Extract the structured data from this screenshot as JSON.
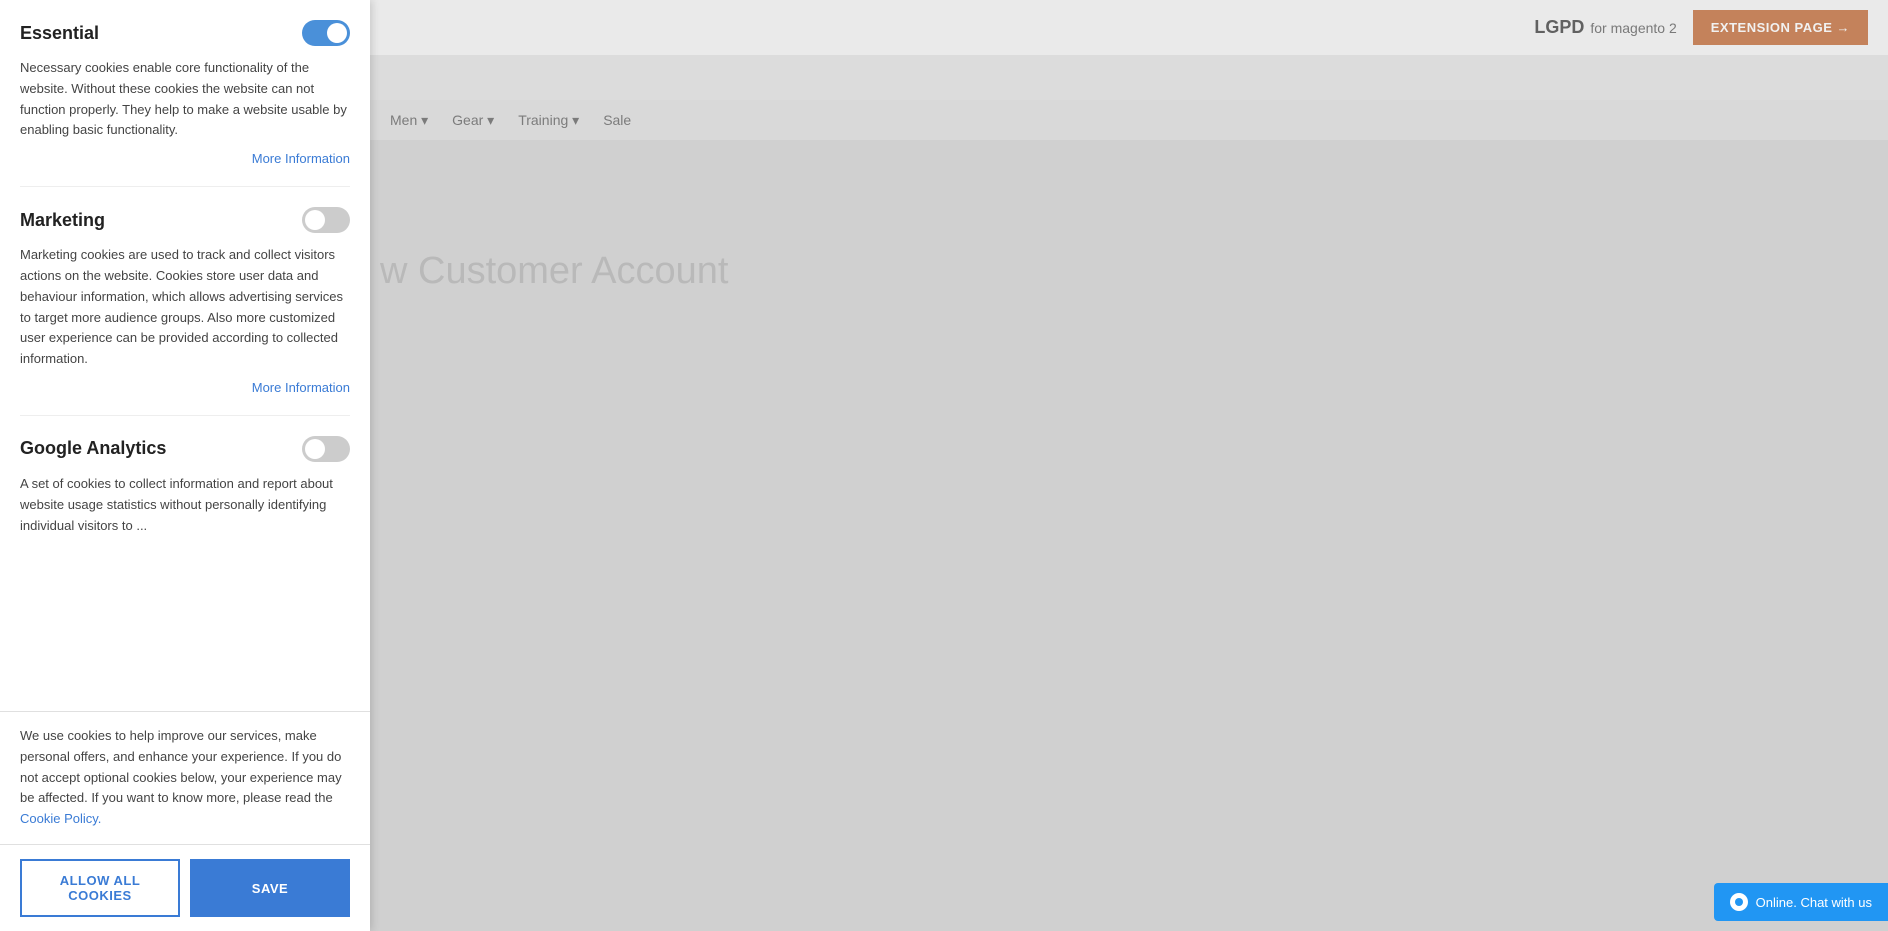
{
  "header": {
    "brand": "LGPD",
    "for_magento": "for magento 2",
    "extension_btn_label": "EXTENSION PAGE →"
  },
  "nav": {
    "items": [
      "Men ▾",
      "Gear ▾",
      "Training ▾",
      "Sale"
    ]
  },
  "page_title": "w Customer Account",
  "cookie_panel": {
    "sections": [
      {
        "id": "essential",
        "title": "Essential",
        "toggle_on": true,
        "description": "Necessary cookies enable core functionality of the website. Without these cookies the website can not function properly. They help to make a website usable by enabling basic functionality.",
        "more_info_label": "More Information"
      },
      {
        "id": "marketing",
        "title": "Marketing",
        "toggle_on": false,
        "description": "Marketing cookies are used to track and collect visitors actions on the website. Cookies store user data and behaviour information, which allows advertising services to target more audience groups. Also more customized user experience can be provided according to collected information.",
        "more_info_label": "More Information"
      },
      {
        "id": "google-analytics",
        "title": "Google Analytics",
        "toggle_on": false,
        "description": "A set of cookies to collect information and report about website usage statistics without personally identifying individual visitors to ..."
      }
    ],
    "bottom_notice": "We use cookies to help improve our services, make personal offers, and enhance your experience. If you do not accept optional cookies below, your experience may be affected. If you want to know more, please read the",
    "cookie_policy_link": "Cookie Policy.",
    "allow_all_label": "ALLOW ALL COOKIES",
    "save_label": "SAVE"
  },
  "chat_widget": {
    "label": "Online. Chat with us"
  }
}
